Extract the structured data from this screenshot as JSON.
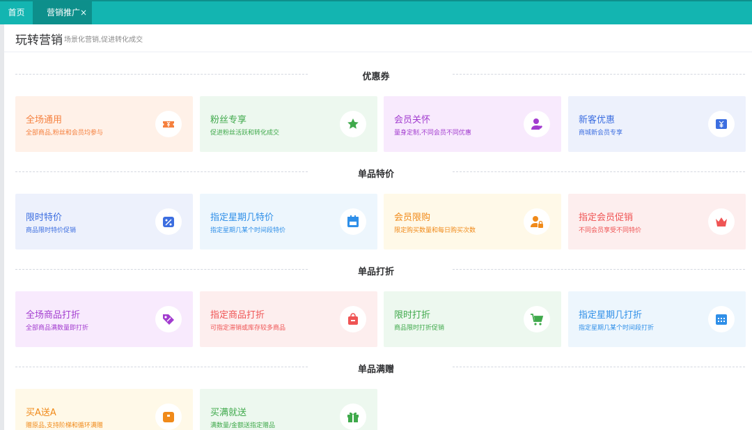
{
  "tabs": [
    {
      "label": "首页"
    },
    {
      "label": "营销推广",
      "close": "×"
    }
  ],
  "header": {
    "title": "玩转营销",
    "subtitle": "场景化营销,促进转化成交"
  },
  "sections": [
    {
      "title": "优惠券",
      "cards": [
        {
          "title": "全场通用",
          "desc": "全部商品,粉丝和会员均参与",
          "icon": "coupon-ticket-icon",
          "bg": "#fff1e8",
          "color": "#f5803e"
        },
        {
          "title": "粉丝专享",
          "desc": "促进粉丝活跃和转化成交",
          "icon": "star-icon",
          "bg": "#edf8ef",
          "color": "#3fa94b"
        },
        {
          "title": "会员关怀",
          "desc": "量身定制,不同会员不同优惠",
          "icon": "member-heart-icon",
          "bg": "#f8eafd",
          "color": "#a23ccf"
        },
        {
          "title": "新客优惠",
          "desc": "商城新会员专享",
          "icon": "new-customer-ticket-icon",
          "bg": "#edf1fc",
          "color": "#3c6ee0"
        }
      ]
    },
    {
      "title": "单品特价",
      "cards": [
        {
          "title": "限时特价",
          "desc": "商品限时特价促销",
          "icon": "percent-tag-icon",
          "bg": "#edf1fc",
          "color": "#3c6ee0"
        },
        {
          "title": "指定星期几特价",
          "desc": "指定星期几某个时间段特价",
          "icon": "calendar-icon",
          "bg": "#edf6fd",
          "color": "#2f8fe8"
        },
        {
          "title": "会员限购",
          "desc": "限定购买数量和每日购买次数",
          "icon": "member-lock-icon",
          "bg": "#fff9e8",
          "color": "#f08a1a"
        },
        {
          "title": "指定会员促销",
          "desc": "不同会员享受不同特价",
          "icon": "crown-icon",
          "bg": "#fdeeee",
          "color": "#ef5454"
        }
      ]
    },
    {
      "title": "单品打折",
      "cards": [
        {
          "title": "全场商品打折",
          "desc": "全部商品满数量即打折",
          "icon": "discount-tag-icon",
          "bg": "#f8eafd",
          "color": "#a23ccf"
        },
        {
          "title": "指定商品打折",
          "desc": "可指定滞销或库存较多商品",
          "icon": "shopping-bag-icon",
          "bg": "#fdeeee",
          "color": "#ef5454"
        },
        {
          "title": "限时打折",
          "desc": "商品限时打折促销",
          "icon": "cart-icon",
          "bg": "#edf8ef",
          "color": "#3fa94b"
        },
        {
          "title": "指定星期几打折",
          "desc": "指定星期几某个时间段打折",
          "icon": "calendar-grid-icon",
          "bg": "#edf6fd",
          "color": "#2f8fe8"
        }
      ]
    },
    {
      "title": "单品满赠",
      "cards": [
        {
          "title": "买A送A",
          "desc": "赠原品,支持阶梯和循环满赠",
          "icon": "gift-box-icon",
          "bg": "#fff9e8",
          "color": "#f08a1a"
        },
        {
          "title": "买满就送",
          "desc": "满数量/金额送指定赠品",
          "icon": "gift-icon",
          "bg": "#edf8ef",
          "color": "#3fa94b"
        }
      ]
    }
  ]
}
